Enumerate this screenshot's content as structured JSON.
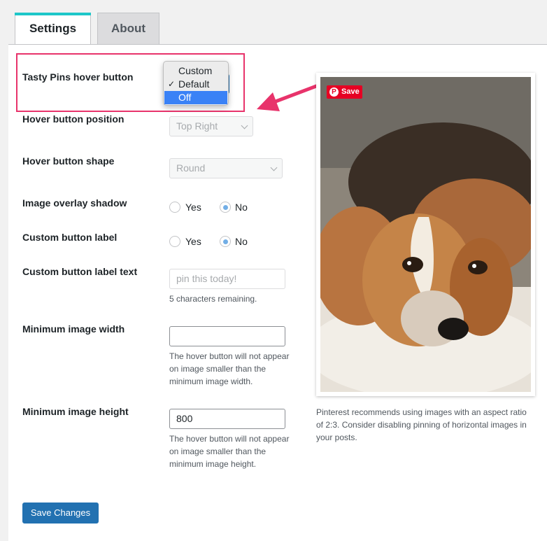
{
  "tabs": [
    {
      "label": "Settings",
      "active": true
    },
    {
      "label": "About",
      "active": false
    }
  ],
  "fields": {
    "hover_button": {
      "label": "Tasty Pins hover button",
      "options": [
        "Custom",
        "Default",
        "Off"
      ],
      "checked": "Default",
      "highlighted": "Off",
      "check_mark": "✓"
    },
    "position": {
      "label": "Hover button position",
      "value": "Top Right"
    },
    "shape": {
      "label": "Hover button shape",
      "value": "Round"
    },
    "overlay_shadow": {
      "label": "Image overlay shadow",
      "yes": "Yes",
      "no": "No",
      "selected": "No"
    },
    "custom_label": {
      "label": "Custom button label",
      "yes": "Yes",
      "no": "No",
      "selected": "No"
    },
    "custom_label_text": {
      "label": "Custom button label text",
      "placeholder": "pin this today!",
      "help": "5 characters remaining."
    },
    "min_width": {
      "label": "Minimum image width",
      "value": "",
      "help": "The hover button will not appear on image smaller than the minimum image width."
    },
    "min_height": {
      "label": "Minimum image height",
      "value": "800",
      "help": "The hover button will not appear on image smaller than the minimum image height."
    }
  },
  "save_button": "Save Changes",
  "preview": {
    "pin_label": "Save",
    "pin_glyph": "P",
    "note": "Pinterest recommends using images with an aspect ratio of 2:3. Consider disabling pinning of horizontal images in your posts."
  },
  "colors": {
    "accent": "#2271b1",
    "tab_accent": "#1ec7c9",
    "highlight": "#e8336b",
    "pinterest": "#e60023"
  }
}
